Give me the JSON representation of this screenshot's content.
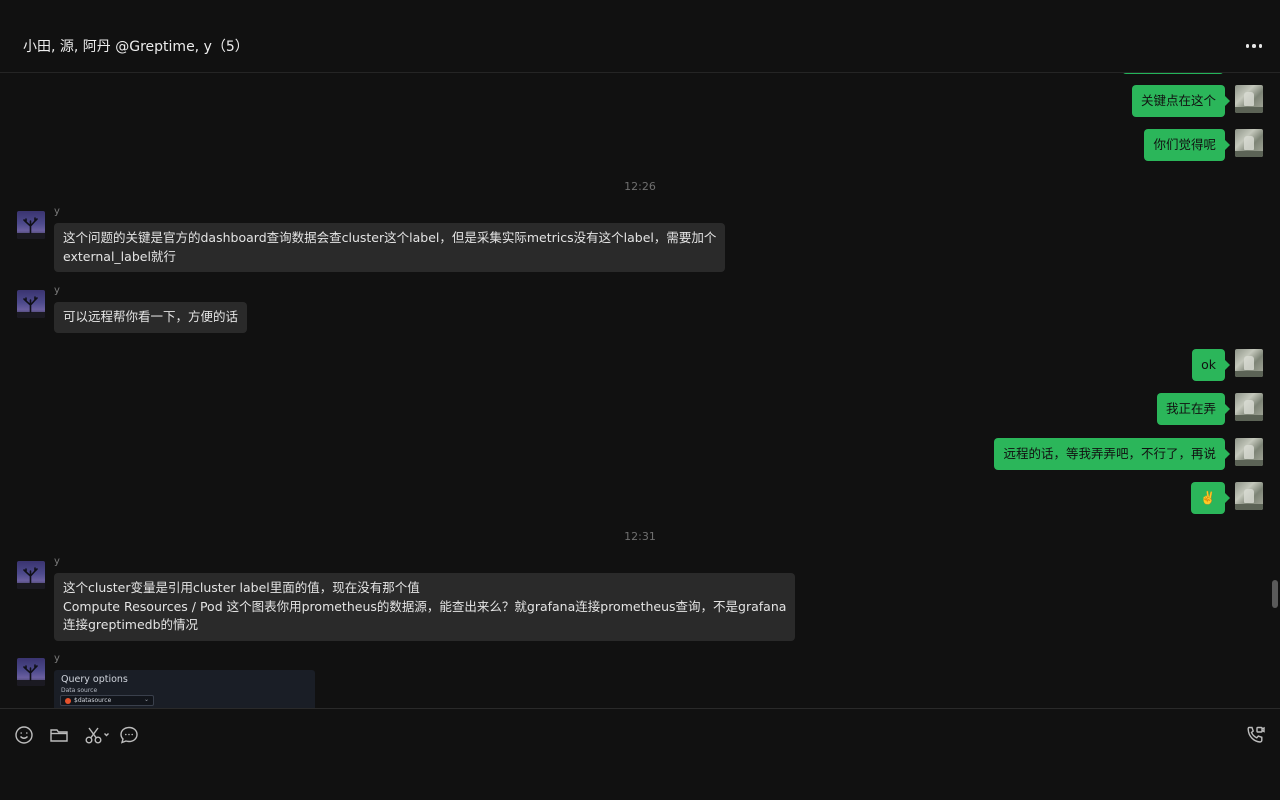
{
  "header": {
    "title": "小田, 源, 阿丹 @Greptime, y（5）"
  },
  "messages": {
    "m1": "关键点在这个",
    "m2": "你们觉得呢",
    "time1": "12:26",
    "m3_sender": "y",
    "m3_lines": [
      "这个问题的关键是官方的dashboard查询数据会查cluster这个label，但是采集实际metrics没有这个label，需要加个",
      "external_label就行"
    ],
    "m4_sender": "y",
    "m4": "可以远程帮你看一下，方便的话",
    "m5": "ok",
    "m6": "我正在弄",
    "m7": "远程的话，等我弄弄吧，不行了，再说",
    "m8": "✌️",
    "time2": "12:31",
    "m9_sender": "y",
    "m9_lines": [
      "这个cluster变量是引用cluster label里面的值，现在没有那个值",
      "Compute Resources / Pod 这个图表你用prometheus的数据源，能查出来么？就grafana连接prometheus查询，不是grafana",
      "连接greptimedb的情况"
    ],
    "m10_sender": "y",
    "m10_image": {
      "title": "Query options",
      "subtitle": "Data source",
      "select_value": "$datasource"
    }
  },
  "footer": {
    "tools": [
      "emoji-icon",
      "folder-icon",
      "scissors-icon",
      "chat-icon",
      "phone-video-icon"
    ]
  },
  "colors": {
    "background": "#111111",
    "my_bubble": "#2bb65a",
    "their_bubble": "#2a2a2a"
  }
}
